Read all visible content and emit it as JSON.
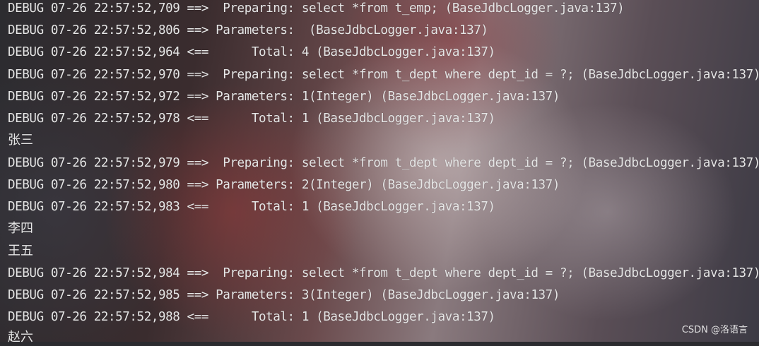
{
  "console": {
    "lines": [
      "DEBUG 07-26 22:57:52,709 ==>  Preparing: select *from t_emp; (BaseJdbcLogger.java:137)",
      "DEBUG 07-26 22:57:52,806 ==> Parameters:  (BaseJdbcLogger.java:137)",
      "DEBUG 07-26 22:57:52,964 <==      Total: 4 (BaseJdbcLogger.java:137)",
      "DEBUG 07-26 22:57:52,970 ==>  Preparing: select *from t_dept where dept_id = ?; (BaseJdbcLogger.java:137)",
      "DEBUG 07-26 22:57:52,972 ==> Parameters: 1(Integer) (BaseJdbcLogger.java:137)",
      "DEBUG 07-26 22:57:52,978 <==      Total: 1 (BaseJdbcLogger.java:137)",
      "张三",
      "DEBUG 07-26 22:57:52,979 ==>  Preparing: select *from t_dept where dept_id = ?; (BaseJdbcLogger.java:137)",
      "DEBUG 07-26 22:57:52,980 ==> Parameters: 2(Integer) (BaseJdbcLogger.java:137)",
      "DEBUG 07-26 22:57:52,983 <==      Total: 1 (BaseJdbcLogger.java:137)",
      "李四",
      "王五",
      "DEBUG 07-26 22:57:52,984 ==>  Preparing: select *from t_dept where dept_id = ?; (BaseJdbcLogger.java:137)",
      "DEBUG 07-26 22:57:52,985 ==> Parameters: 3(Integer) (BaseJdbcLogger.java:137)",
      "DEBUG 07-26 22:57:52,988 <==      Total: 1 (BaseJdbcLogger.java:137)",
      "赵六"
    ]
  },
  "watermark": "CSDN @洛语言"
}
